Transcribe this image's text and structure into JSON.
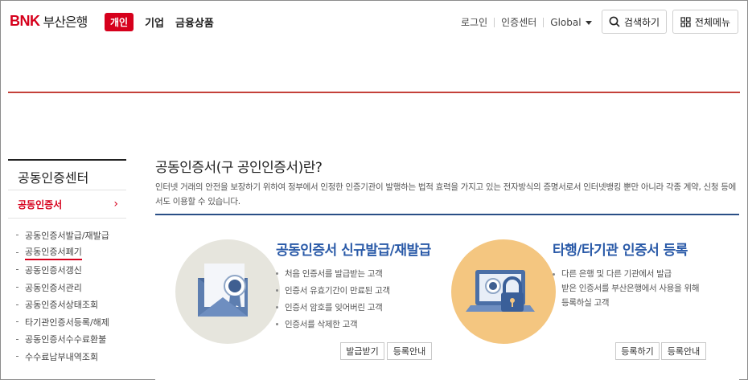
{
  "header": {
    "logo_bnk": "BNK",
    "logo_bank": "부산은행",
    "nav": {
      "active": "개인",
      "items": [
        "기업",
        "금융상품"
      ]
    },
    "util": {
      "login": "로그인",
      "cert_center": "인증센터",
      "global": "Global"
    },
    "search_label": "검색하기",
    "menu_label": "전체메뉴"
  },
  "sidebar": {
    "title": "공동인증센터",
    "active_label": "공동인증서",
    "items": [
      {
        "label": "공동인증서발급/재발급"
      },
      {
        "label": "공동인증서폐기"
      },
      {
        "label": "공동인증서갱신"
      },
      {
        "label": "공동인증서관리"
      },
      {
        "label": "공동인증서상태조회"
      },
      {
        "label": "타기관인증서등록/해제"
      },
      {
        "label": "공동인증서수수료환불"
      },
      {
        "label": "수수료납부내역조회"
      }
    ],
    "current_index": 1
  },
  "main": {
    "title": "공동인증서(구 공인인증서)란?",
    "desc": "인터넷 거래의 안전을 보장하기 위하여 정부에서 인정한 인증기관이 발행하는 법적 효력을 가지고 있는 전자방식의 증명서로서 인터넷뱅킹 뿐만 아니라 각종 계약, 신청 등에서도 이용할 수 있습니다.",
    "card1": {
      "title": "공동인증서 신규발급/재발급",
      "bullets": [
        "처음 인증서를 발급받는 고객",
        "인증서 유효기간이 만료된 고객",
        "인증서 암호를 잊어버린 고객",
        "인증서를 삭제한 고객"
      ],
      "btn_issue": "발급받기",
      "btn_guide": "등록안내"
    },
    "card2": {
      "title": "타행/타기관 인증서 등록",
      "line1": "다른 은행 및 다른 기관에서 발급",
      "line2": "받은 인증서를 부산은행에서 사용을 위해",
      "line3": "등록하실 고객",
      "btn_register": "등록하기",
      "btn_guide": "등록안내"
    }
  },
  "colors": {
    "brand_red": "#d6001c",
    "accent_blue": "#2a5aa8",
    "panel_line": "#2a4f86"
  }
}
